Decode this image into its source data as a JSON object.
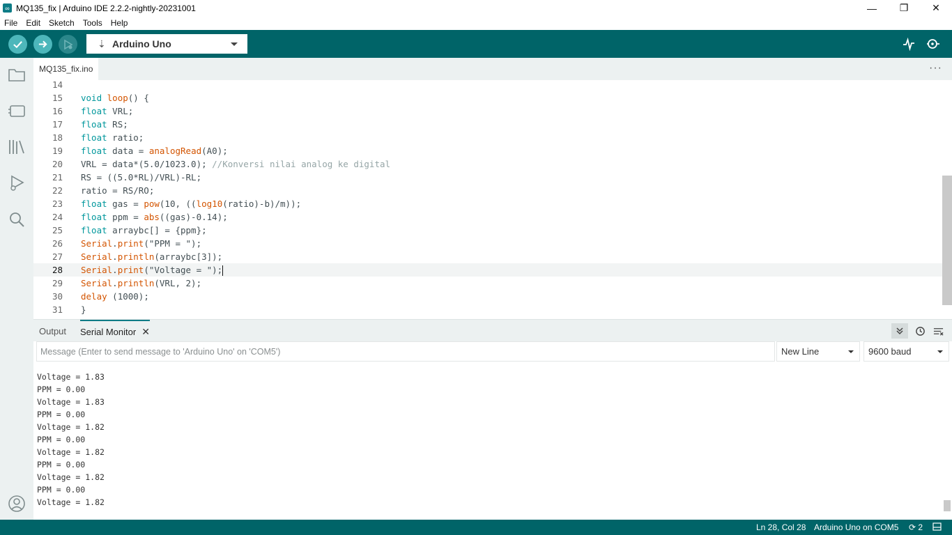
{
  "window": {
    "title": "MQ135_fix | Arduino IDE 2.2.2-nightly-20231001",
    "minimize": "—",
    "restore": "❐",
    "close": "✕"
  },
  "menu": [
    "File",
    "Edit",
    "Sketch",
    "Tools",
    "Help"
  ],
  "toolbar": {
    "board": "Arduino Uno",
    "verify_icon": "check-icon",
    "upload_icon": "arrow-right-icon",
    "debug_icon": "debug-icon",
    "plotter_icon": "serial-plotter-icon",
    "monitor_icon": "serial-monitor-icon"
  },
  "editor": {
    "tab": "MQ135_fix.ino",
    "more": "···",
    "lines": [
      {
        "n": "14",
        "html": ""
      },
      {
        "n": "15",
        "html": "<span class=\"kw\">void</span> <span class=\"fn\">loop</span>() {"
      },
      {
        "n": "16",
        "html": "<span class=\"kw\">float</span> VRL;"
      },
      {
        "n": "17",
        "html": "<span class=\"kw\">float</span> RS;"
      },
      {
        "n": "18",
        "html": "<span class=\"kw\">float</span> ratio;"
      },
      {
        "n": "19",
        "html": "<span class=\"kw\">float</span> data = <span class=\"fn\">analogRead</span>(A0);"
      },
      {
        "n": "20",
        "html": "VRL = data*(5.0/1023.0); <span class=\"cm\">//Konversi nilai analog ke digital</span>"
      },
      {
        "n": "21",
        "html": "RS = ((5.0*RL)/VRL)-RL;"
      },
      {
        "n": "22",
        "html": "ratio = RS/RO;"
      },
      {
        "n": "23",
        "html": "<span class=\"kw\">float</span> gas = <span class=\"fn\">pow</span>(10, ((<span class=\"fn\">log10</span>(ratio)-b)/m));"
      },
      {
        "n": "24",
        "html": "<span class=\"kw\">float</span> ppm = <span class=\"fn\">abs</span>((gas)-0.14);"
      },
      {
        "n": "25",
        "html": "<span class=\"kw\">float</span> arraybc[] = {ppm};"
      },
      {
        "n": "26",
        "html": "<span class=\"fn\">Serial</span>.<span class=\"fn\">print</span>(\"PPM = \");"
      },
      {
        "n": "27",
        "html": "<span class=\"fn\">Serial</span>.<span class=\"fn\">println</span>(arraybc[3]);"
      },
      {
        "n": "28",
        "html": "<span class=\"fn\">Serial</span>.<span class=\"fn\">print</span>(\"Voltage = \");<span class=\"caret\"></span>"
      },
      {
        "n": "29",
        "html": "<span class=\"fn\">Serial</span>.<span class=\"fn\">println</span>(VRL, 2);"
      },
      {
        "n": "30",
        "html": "<span class=\"fn\">delay</span> (1000);"
      },
      {
        "n": "31",
        "html": "}"
      }
    ],
    "active_line": "28"
  },
  "panel": {
    "tabs": [
      "Output",
      "Serial Monitor"
    ],
    "active_tab": "Serial Monitor",
    "close_glyph": "✕",
    "message_placeholder": "Message (Enter to send message to 'Arduino Uno' on 'COM5')",
    "line_ending": "New Line",
    "baud": "9600 baud",
    "output": [
      "Voltage = 1.83",
      "PPM = 0.00",
      "Voltage = 1.83",
      "PPM = 0.00",
      "Voltage = 1.82",
      "PPM = 0.00",
      "Voltage = 1.82",
      "PPM = 0.00",
      "Voltage = 1.82",
      "PPM = 0.00",
      "Voltage = 1.82"
    ]
  },
  "status": {
    "position": "Ln 28, Col 28",
    "board": "Arduino Uno on COM5",
    "notifications": "2"
  },
  "colors": {
    "teal_dark": "#006468",
    "teal_button": "#4db7bb",
    "keyword": "#00979c",
    "function": "#d35400"
  }
}
